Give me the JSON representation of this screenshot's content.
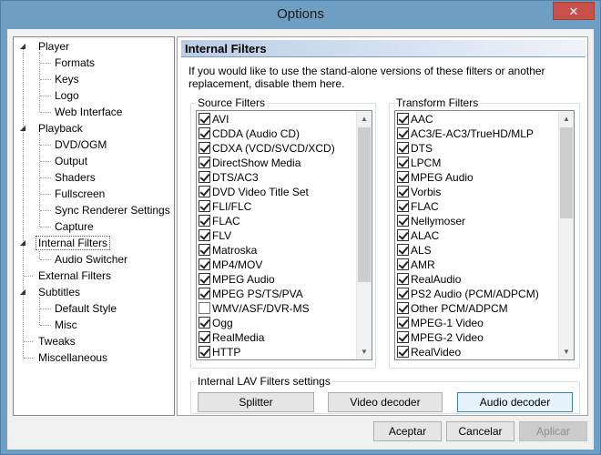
{
  "window": {
    "title": "Options",
    "close_glyph": "✕"
  },
  "tree": {
    "items": [
      {
        "label": "Player",
        "level": 0,
        "expanded": true
      },
      {
        "label": "Formats",
        "level": 1
      },
      {
        "label": "Keys",
        "level": 1
      },
      {
        "label": "Logo",
        "level": 1
      },
      {
        "label": "Web Interface",
        "level": 1
      },
      {
        "label": "Playback",
        "level": 0,
        "expanded": true
      },
      {
        "label": "DVD/OGM",
        "level": 1
      },
      {
        "label": "Output",
        "level": 1
      },
      {
        "label": "Shaders",
        "level": 1
      },
      {
        "label": "Fullscreen",
        "level": 1
      },
      {
        "label": "Sync Renderer Settings",
        "level": 1
      },
      {
        "label": "Capture",
        "level": 1
      },
      {
        "label": "Internal Filters",
        "level": 0,
        "expanded": true,
        "selected": true
      },
      {
        "label": "Audio Switcher",
        "level": 1
      },
      {
        "label": "External Filters",
        "level": 0
      },
      {
        "label": "Subtitles",
        "level": 0,
        "expanded": true
      },
      {
        "label": "Default Style",
        "level": 1
      },
      {
        "label": "Misc",
        "level": 1
      },
      {
        "label": "Tweaks",
        "level": 0
      },
      {
        "label": "Miscellaneous",
        "level": 0
      }
    ]
  },
  "panel": {
    "header": "Internal Filters",
    "description": "If you would like to use the stand-alone versions of these filters or another replacement, disable them here.",
    "source_filters": {
      "label": "Source Filters",
      "items": [
        {
          "label": "AVI",
          "checked": true
        },
        {
          "label": "CDDA (Audio CD)",
          "checked": true
        },
        {
          "label": "CDXA (VCD/SVCD/XCD)",
          "checked": true
        },
        {
          "label": "DirectShow Media",
          "checked": true
        },
        {
          "label": "DTS/AC3",
          "checked": true
        },
        {
          "label": "DVD Video Title Set",
          "checked": true
        },
        {
          "label": "FLI/FLC",
          "checked": true
        },
        {
          "label": "FLAC",
          "checked": true
        },
        {
          "label": "FLV",
          "checked": true
        },
        {
          "label": "Matroska",
          "checked": true
        },
        {
          "label": "MP4/MOV",
          "checked": true
        },
        {
          "label": "MPEG Audio",
          "checked": true
        },
        {
          "label": "MPEG PS/TS/PVA",
          "checked": true
        },
        {
          "label": "WMV/ASF/DVR-MS",
          "checked": false
        },
        {
          "label": "Ogg",
          "checked": true
        },
        {
          "label": "RealMedia",
          "checked": true
        },
        {
          "label": "HTTP",
          "checked": true
        }
      ]
    },
    "transform_filters": {
      "label": "Transform Filters",
      "items": [
        {
          "label": "AAC",
          "checked": true
        },
        {
          "label": "AC3/E-AC3/TrueHD/MLP",
          "checked": true
        },
        {
          "label": "DTS",
          "checked": true
        },
        {
          "label": "LPCM",
          "checked": true
        },
        {
          "label": "MPEG Audio",
          "checked": true
        },
        {
          "label": "Vorbis",
          "checked": true
        },
        {
          "label": "FLAC",
          "checked": true
        },
        {
          "label": "Nellymoser",
          "checked": true
        },
        {
          "label": "ALAC",
          "checked": true
        },
        {
          "label": "ALS",
          "checked": true
        },
        {
          "label": "AMR",
          "checked": true
        },
        {
          "label": "RealAudio",
          "checked": true
        },
        {
          "label": "PS2 Audio (PCM/ADPCM)",
          "checked": true
        },
        {
          "label": "Other PCM/ADPCM",
          "checked": true
        },
        {
          "label": "MPEG-1 Video",
          "checked": true
        },
        {
          "label": "MPEG-2 Video",
          "checked": true
        },
        {
          "label": "RealVideo",
          "checked": true
        }
      ]
    },
    "lav": {
      "label": "Internal LAV Filters settings",
      "splitter": "Splitter",
      "video_decoder": "Video decoder",
      "audio_decoder": "Audio decoder"
    }
  },
  "footer": {
    "accept": "Aceptar",
    "cancel": "Cancelar",
    "apply": "Aplicar"
  }
}
